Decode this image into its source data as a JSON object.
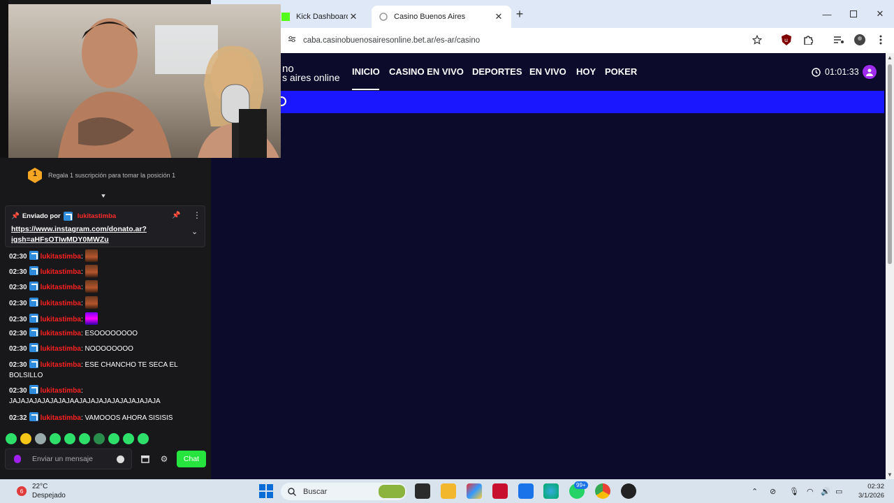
{
  "browser": {
    "tabs": [
      {
        "label": "Kick Dashboard",
        "active": false
      },
      {
        "label": "Casino Buenos Aires",
        "active": true
      }
    ],
    "url": "caba.casinobuenosairesonline.bet.ar/es-ar/casino"
  },
  "casino": {
    "logo_line1": "no",
    "logo_line2": "s aires online",
    "nav": [
      "INICIO",
      "CASINO EN VIVO",
      "DEPORTES",
      "EN VIVO",
      "HOY",
      "POKER"
    ],
    "active_nav": "INICIO",
    "timer": "01:01:33",
    "colors": {
      "bg": "#0d0b2b",
      "banner": "#1a17ff",
      "user": "#a02cf0"
    }
  },
  "chat": {
    "leaderboard_rank": "1",
    "leaderboard_text": "Regala 1 suscripción para tomar la posición 1",
    "pinned": {
      "prefix": "Enviado por",
      "by": "lukitastimba",
      "link": "https://www.instagram.com/donato.ar?igsh=aHFsOTIwMDY0MWZu"
    },
    "messages": [
      {
        "time": "02:30",
        "user": "lukitastimba",
        "text": "",
        "emote": "face"
      },
      {
        "time": "02:30",
        "user": "lukitastimba",
        "text": "",
        "emote": "face"
      },
      {
        "time": "02:30",
        "user": "lukitastimba",
        "text": "",
        "emote": "face"
      },
      {
        "time": "02:30",
        "user": "lukitastimba",
        "text": "",
        "emote": "face"
      },
      {
        "time": "02:30",
        "user": "lukitastimba",
        "text": "",
        "emote": "purple"
      },
      {
        "time": "02:30",
        "user": "lukitastimba",
        "text": "ESOOOOOOOO"
      },
      {
        "time": "02:30",
        "user": "lukitastimba",
        "text": "NOOOOOOOO"
      },
      {
        "time": "02:30",
        "user": "lukitastimba",
        "text": "ESE CHANCHO TE SECA EL BOLSILLO"
      },
      {
        "time": "02:30",
        "user": "lukitastimba",
        "text": "JAJAJAJAJAJAJAJAAJAJAJAJAJAJAJAJAJAJA"
      },
      {
        "time": "02:32",
        "user": "lukitastimba",
        "text": "VAMOOOS AHORA SISISIS"
      }
    ],
    "input_placeholder": "Enviar un mensaje",
    "send_label": "Chat",
    "accent": "#27e33d"
  },
  "taskbar": {
    "temperature": "22°C",
    "condition": "Despejado",
    "weather_badge": "6",
    "search_label": "Buscar",
    "time": "02:32",
    "date": "3/1/2026",
    "notif_badge": "99+"
  }
}
